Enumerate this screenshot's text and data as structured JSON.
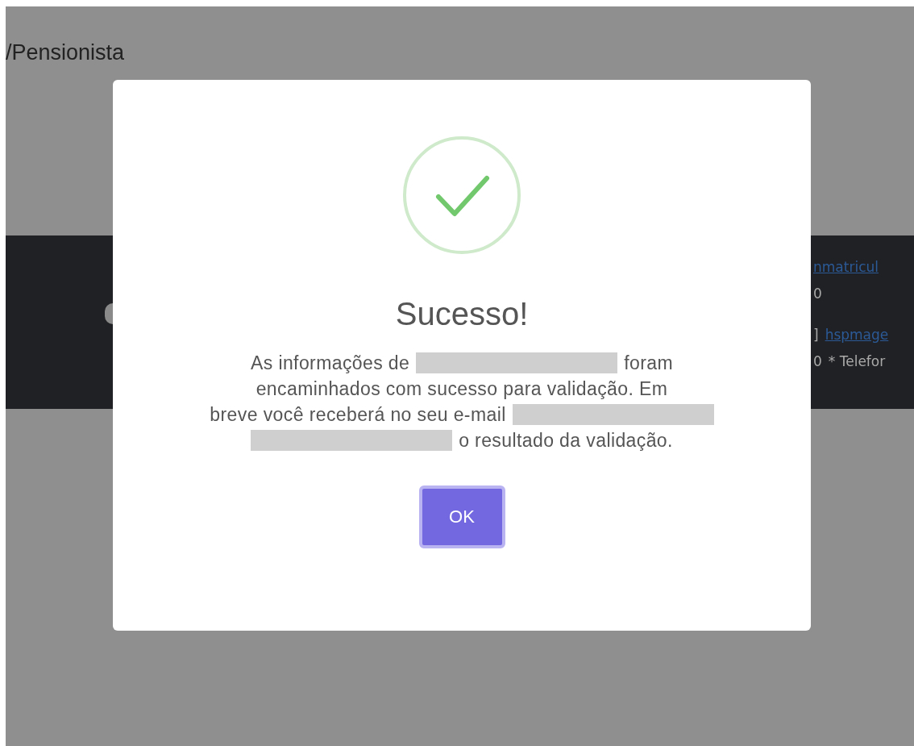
{
  "page": {
    "heading": "/Pensionista",
    "band_lines": [
      [
        {
          "kind": "link",
          "text": "nmatricul"
        }
      ],
      [
        {
          "kind": "text",
          "text": "0"
        }
      ],
      [
        {
          "kind": "text",
          "text": "]"
        },
        {
          "kind": "link",
          "text": "hspmage"
        }
      ],
      [
        {
          "kind": "text",
          "text": "0"
        },
        {
          "kind": "text",
          "text": "* Telefor"
        }
      ]
    ]
  },
  "dialog": {
    "title": "Sucesso!",
    "message_lines": [
      [
        {
          "kind": "text",
          "text": "As informações de"
        },
        {
          "kind": "redacted"
        },
        {
          "kind": "text",
          "text": "foram"
        }
      ],
      [
        {
          "kind": "text",
          "text": "encaminhados com sucesso para validação. Em"
        }
      ],
      [
        {
          "kind": "text",
          "text": "breve você receberá no seu e-mail"
        },
        {
          "kind": "redacted"
        }
      ],
      [
        {
          "kind": "redacted"
        },
        {
          "kind": "text",
          "text": "o resultado da validação."
        }
      ]
    ],
    "button": "OK"
  }
}
